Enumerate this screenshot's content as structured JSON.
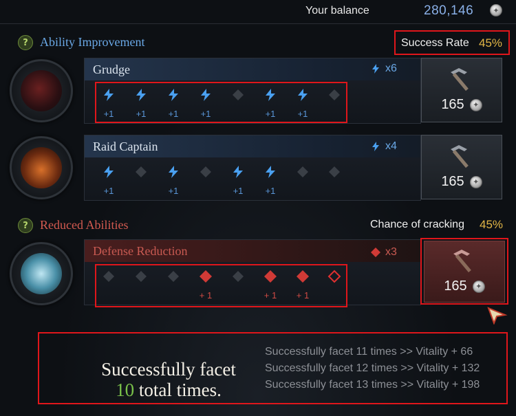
{
  "balance": {
    "label": "Your balance",
    "value": "280,146"
  },
  "icons": {
    "help_glyph": "?"
  },
  "colors": {
    "blue_rune": "#4aa0f0",
    "red_rune": "#d03a36",
    "empty_rune": "#3a3f46",
    "rate_accent": "#e2b646",
    "highlight_border": "#e0161b"
  },
  "sections": {
    "improvement": {
      "title": "Ability Improvement",
      "rate_label": "Success Rate",
      "rate_value": "45%"
    },
    "reduced": {
      "title": "Reduced Abilities",
      "rate_label": "Chance of cracking",
      "rate_value": "45%"
    }
  },
  "engravings": [
    {
      "name": "Grudge",
      "count": "x6",
      "cost": "165",
      "kind": "blue",
      "slots": [
        "success",
        "success",
        "success",
        "success",
        "fail",
        "success",
        "success",
        "empty"
      ],
      "plus_label": "+1"
    },
    {
      "name": "Raid Captain",
      "count": "x4",
      "cost": "165",
      "kind": "blue",
      "slots": [
        "success",
        "fail",
        "success",
        "fail",
        "success",
        "success",
        "fail",
        "empty"
      ],
      "plus_label": "+1"
    },
    {
      "name": "Defense Reduction",
      "count": "x3",
      "cost": "165",
      "kind": "red",
      "slots": [
        "fail",
        "fail",
        "fail",
        "success",
        "fail",
        "success",
        "success",
        "next"
      ],
      "plus_label": "+ 1"
    }
  ],
  "summary": {
    "line1": "Successfully facet",
    "count": "10",
    "line2": "total times.",
    "bonuses": [
      "Successfully facet 11 times >> Vitality + 66",
      "Successfully facet 12 times >> Vitality + 132",
      "Successfully facet 13 times >> Vitality + 198"
    ]
  }
}
